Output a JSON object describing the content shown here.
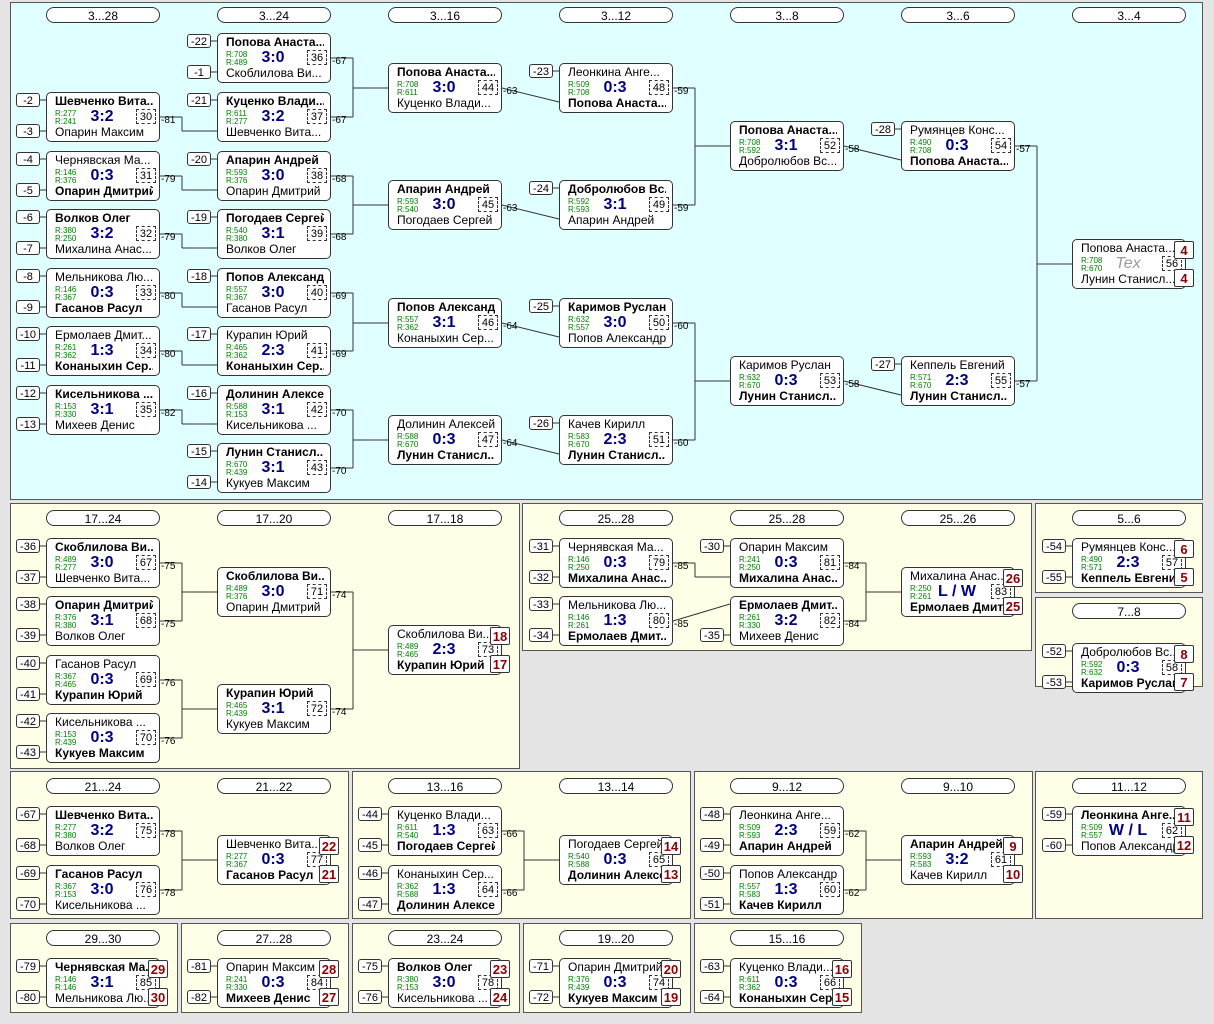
{
  "colors": {
    "top_bg": "#e0ffff",
    "lower_bg": "#ffffe8",
    "outer_bg": "#e4e4e4",
    "win": "#000000",
    "score": "#000080",
    "rating": "#008000",
    "place": "#8b0000"
  },
  "panels": [
    {
      "id": "p1",
      "headers": [
        "3...28",
        "3...24",
        "3...16",
        "3...12",
        "3...8",
        "3...6",
        "3...4"
      ]
    },
    {
      "id": "p2",
      "headers": [
        "17...24",
        "17...20",
        "17...18"
      ]
    },
    {
      "id": "p3",
      "headers": [
        "25...28",
        "25...28",
        "25...26"
      ]
    },
    {
      "id": "p4",
      "headers": [
        "5...6"
      ]
    },
    {
      "id": "p5",
      "headers": [
        "7...8"
      ]
    },
    {
      "id": "p6",
      "headers": [
        "21...24",
        "21...22"
      ]
    },
    {
      "id": "p7",
      "headers": [
        "13...16",
        "13...14"
      ]
    },
    {
      "id": "p8",
      "headers": [
        "9...12",
        "9...10"
      ]
    },
    {
      "id": "p9",
      "headers": [
        "11...12"
      ]
    },
    {
      "id": "p10",
      "headers": [
        "29...30"
      ]
    },
    {
      "id": "p11",
      "headers": [
        "27...28"
      ]
    },
    {
      "id": "p12",
      "headers": [
        "23...24"
      ]
    },
    {
      "id": "p13",
      "headers": [
        "19...20"
      ]
    },
    {
      "id": "p14",
      "headers": [
        "15...16"
      ]
    }
  ],
  "matches": [
    {
      "n1": "Попова Анаста...",
      "n2": "Скоблилова Ви...",
      "r1": "R:708",
      "r2": "R:489",
      "score": "3:0",
      "num": "36",
      "w": 1,
      "s1": "-22",
      "s2": "-1",
      "out": "-67"
    },
    {
      "n1": "Шевченко Вита...",
      "n2": "Опарин Максим",
      "r1": "R:277",
      "r2": "R:241",
      "score": "3:2",
      "num": "30",
      "w": 1,
      "s1": "-2",
      "s2": "-3",
      "out": "-81"
    },
    {
      "n1": "Куценко Влади...",
      "n2": "Шевченко Вита...",
      "r1": "R:611",
      "r2": "R:277",
      "score": "3:2",
      "num": "37",
      "w": 1,
      "s1": "-21",
      "out": "-67"
    },
    {
      "n1": "Чернявская Ма...",
      "n2": "Опарин Дмитрий",
      "r1": "R:146",
      "r2": "R:376",
      "score": "0:3",
      "num": "31",
      "w": 2,
      "s1": "-4",
      "s2": "-5",
      "out": "-79"
    },
    {
      "n1": "Апарин Андрей",
      "n2": "Опарин Дмитрий",
      "r1": "R:593",
      "r2": "R:376",
      "score": "3:0",
      "num": "38",
      "w": 1,
      "s1": "-20",
      "out": "-68"
    },
    {
      "n1": "Волков Олег",
      "n2": "Михалина Анас...",
      "r1": "R:380",
      "r2": "R:250",
      "score": "3:2",
      "num": "32",
      "w": 1,
      "s1": "-6",
      "s2": "-7",
      "out": "-79"
    },
    {
      "n1": "Погодаев Сергей",
      "n2": "Волков Олег",
      "r1": "R:540",
      "r2": "R:380",
      "score": "3:1",
      "num": "39",
      "w": 1,
      "s1": "-19",
      "out": "-68"
    },
    {
      "n1": "Мельникова Лю...",
      "n2": "Гасанов Расул",
      "r1": "R:146",
      "r2": "R:367",
      "score": "0:3",
      "num": "33",
      "w": 2,
      "s1": "-8",
      "s2": "-9",
      "out": "-80"
    },
    {
      "n1": "Попов Александр",
      "n2": "Гасанов Расул",
      "r1": "R:557",
      "r2": "R:367",
      "score": "3:0",
      "num": "40",
      "w": 1,
      "s1": "-18",
      "out": "-69"
    },
    {
      "n1": "Ермолаев Дмит...",
      "n2": "Конаныхин Сер...",
      "r1": "R:261",
      "r2": "R:362",
      "score": "1:3",
      "num": "34",
      "w": 2,
      "s1": "-10",
      "s2": "-11",
      "out": "-80"
    },
    {
      "n1": "Курапин Юрий",
      "n2": "Конаныхин Сер...",
      "r1": "R:465",
      "r2": "R:362",
      "score": "2:3",
      "num": "41",
      "w": 2,
      "s1": "-17",
      "out": "-69"
    },
    {
      "n1": "Кисельникова ...",
      "n2": "Михеев Денис",
      "r1": "R:153",
      "r2": "R:330",
      "score": "3:1",
      "num": "35",
      "w": 1,
      "s1": "-12",
      "s2": "-13",
      "out": "-82"
    },
    {
      "n1": "Долинин Алексей",
      "n2": "Кисельникова ...",
      "r1": "R:588",
      "r2": "R:153",
      "score": "3:1",
      "num": "42",
      "w": 1,
      "s1": "-16",
      "out": "-70"
    },
    {
      "n1": "Лунин Станисл...",
      "n2": "Кукуев Максим",
      "r1": "R:670",
      "r2": "R:439",
      "score": "3:1",
      "num": "43",
      "w": 1,
      "s1": "-15",
      "s2": "-14",
      "out": "-70"
    },
    {
      "n1": "Попова Анаста...",
      "n2": "Куценко Влади...",
      "r1": "R:708",
      "r2": "R:611",
      "score": "3:0",
      "num": "44",
      "w": 1,
      "out": "-63"
    },
    {
      "n1": "Апарин Андрей",
      "n2": "Погодаев Сергей",
      "r1": "R:593",
      "r2": "R:540",
      "score": "3:0",
      "num": "45",
      "w": 1,
      "out": "-63"
    },
    {
      "n1": "Попов Александр",
      "n2": "Конаныхин Сер...",
      "r1": "R:557",
      "r2": "R:362",
      "score": "3:1",
      "num": "46",
      "w": 1,
      "out": "-64"
    },
    {
      "n1": "Долинин Алексей",
      "n2": "Лунин Станисл...",
      "r1": "R:588",
      "r2": "R:670",
      "score": "0:3",
      "num": "47",
      "w": 2,
      "out": "-64"
    },
    {
      "n1": "Леонкина Анге...",
      "n2": "Попова Анаста...",
      "r1": "R:509",
      "r2": "R:708",
      "score": "0:3",
      "num": "48",
      "w": 2,
      "s1": "-23",
      "out": "-59"
    },
    {
      "n1": "Добролюбов Вс...",
      "n2": "Апарин Андрей",
      "r1": "R:592",
      "r2": "R:593",
      "score": "3:1",
      "num": "49",
      "w": 1,
      "s1": "-24",
      "out": "-59"
    },
    {
      "n1": "Каримов Руслан",
      "n2": "Попов Александр",
      "r1": "R:632",
      "r2": "R:557",
      "score": "3:0",
      "num": "50",
      "w": 1,
      "s1": "-25",
      "out": "-60"
    },
    {
      "n1": "Качев Кирилл",
      "n2": "Лунин Станисл...",
      "r1": "R:583",
      "r2": "R:670",
      "score": "2:3",
      "num": "51",
      "w": 2,
      "s1": "-26",
      "out": "-60"
    },
    {
      "n1": "Попова Анаста...",
      "n2": "Добролюбов Вс...",
      "r1": "R:708",
      "r2": "R:592",
      "score": "3:1",
      "num": "52",
      "w": 1,
      "out": "-58"
    },
    {
      "n1": "Каримов Руслан",
      "n2": "Лунин Станисл...",
      "r1": "R:632",
      "r2": "R:670",
      "score": "0:3",
      "num": "53",
      "w": 2,
      "out": "-58"
    },
    {
      "n1": "Румянцев Конс...",
      "n2": "Попова Анаста...",
      "r1": "R:490",
      "r2": "R:708",
      "score": "0:3",
      "num": "54",
      "w": 2,
      "s1": "-28",
      "out": "-57"
    },
    {
      "n1": "Кеппель Евгений",
      "n2": "Лунин Станисл...",
      "r1": "R:571",
      "r2": "R:670",
      "score": "2:3",
      "num": "55",
      "w": 2,
      "s1": "-27",
      "out": "-57"
    },
    {
      "n1": "Попова Анаста...",
      "n2": "Лунин Станисл...",
      "r1": "R:708",
      "r2": "R:670",
      "score": "Tex",
      "tex": 1,
      "num": "56",
      "w": 0,
      "p1": "4",
      "p2": "4"
    },
    {
      "n1": "Скоблилова Ви...",
      "n2": "Шевченко Вита...",
      "r1": "R:489",
      "r2": "R:277",
      "score": "3:0",
      "num": "67",
      "w": 1,
      "s1": "-36",
      "s2": "-37",
      "out": "-75"
    },
    {
      "n1": "Опарин Дмитрий",
      "n2": "Волков Олег",
      "r1": "R:376",
      "r2": "R:380",
      "score": "3:1",
      "num": "68",
      "w": 1,
      "s1": "-38",
      "s2": "-39",
      "out": "-75"
    },
    {
      "n1": "Гасанов Расул",
      "n2": "Курапин Юрий",
      "r1": "R:367",
      "r2": "R:465",
      "score": "0:3",
      "num": "69",
      "w": 2,
      "s1": "-40",
      "s2": "-41",
      "out": "-76"
    },
    {
      "n1": "Кисельникова ...",
      "n2": "Кукуев Максим",
      "r1": "R:153",
      "r2": "R:439",
      "score": "0:3",
      "num": "70",
      "w": 2,
      "s1": "-42",
      "s2": "-43",
      "out": "-76"
    },
    {
      "n1": "Скоблилова Ви...",
      "n2": "Опарин Дмитрий",
      "r1": "R:489",
      "r2": "R:376",
      "score": "3:0",
      "num": "71",
      "w": 1,
      "out": "-74"
    },
    {
      "n1": "Курапин Юрий",
      "n2": "Кукуев Максим",
      "r1": "R:465",
      "r2": "R:439",
      "score": "3:1",
      "num": "72",
      "w": 1,
      "out": "-74"
    },
    {
      "n1": "Скоблилова Ви...",
      "n2": "Курапин Юрий",
      "r1": "R:489",
      "r2": "R:465",
      "score": "2:3",
      "num": "73",
      "w": 2,
      "p1": "18",
      "p2": "17"
    },
    {
      "n1": "Чернявская Ма...",
      "n2": "Михалина Анас...",
      "r1": "R:146",
      "r2": "R:250",
      "score": "0:3",
      "num": "79",
      "w": 2,
      "s1": "-31",
      "s2": "-32",
      "out": "-85"
    },
    {
      "n1": "Мельникова Лю...",
      "n2": "Ермолаев Дмит...",
      "r1": "R:146",
      "r2": "R:261",
      "score": "1:3",
      "num": "80",
      "w": 2,
      "s1": "-33",
      "s2": "-34",
      "out": "-85"
    },
    {
      "n1": "Опарин Максим",
      "n2": "Михалина Анас...",
      "r1": "R:241",
      "r2": "R:250",
      "score": "0:3",
      "num": "81",
      "w": 2,
      "s1": "-30",
      "out": "-84"
    },
    {
      "n1": "Ермолаев Дмит...",
      "n2": "Михеев Денис",
      "r1": "R:261",
      "r2": "R:330",
      "score": "3:2",
      "num": "82",
      "w": 1,
      "s2": "-35",
      "out": "-84"
    },
    {
      "n1": "Михалина Анас...",
      "n2": "Ермолаев Дмит...",
      "r1": "R:250",
      "r2": "R:261",
      "score": "L / W",
      "num": "83",
      "w": 2,
      "p1": "26",
      "p2": "25"
    },
    {
      "n1": "Румянцев Конс...",
      "n2": "Кеппель Евгений",
      "r1": "R:490",
      "r2": "R:571",
      "score": "2:3",
      "num": "57",
      "w": 2,
      "s1": "-54",
      "s2": "-55",
      "p1": "6",
      "p2": "5"
    },
    {
      "n1": "Добролюбов Вс...",
      "n2": "Каримов Руслан",
      "r1": "R:592",
      "r2": "R:632",
      "score": "0:3",
      "num": "58",
      "w": 2,
      "s1": "-52",
      "s2": "-53",
      "p1": "8",
      "p2": "7"
    },
    {
      "n1": "Шевченко Вита...",
      "n2": "Волков Олег",
      "r1": "R:277",
      "r2": "R:380",
      "score": "3:2",
      "num": "75",
      "w": 1,
      "s1": "-67",
      "s2": "-68",
      "out": "-78"
    },
    {
      "n1": "Гасанов Расул",
      "n2": "Кисельникова ...",
      "r1": "R:367",
      "r2": "R:153",
      "score": "3:0",
      "num": "76",
      "w": 1,
      "s1": "-69",
      "s2": "-70",
      "out": "-78"
    },
    {
      "n1": "Шевченко Вита...",
      "n2": "Гасанов Расул",
      "r1": "R:277",
      "r2": "R:367",
      "score": "0:3",
      "num": "77",
      "w": 2,
      "p1": "22",
      "p2": "21"
    },
    {
      "n1": "Куценко Влади...",
      "n2": "Погодаев Сергей",
      "r1": "R:611",
      "r2": "R:540",
      "score": "1:3",
      "num": "63",
      "w": 2,
      "s1": "-44",
      "s2": "-45",
      "out": "-66"
    },
    {
      "n1": "Конаныхин Сер...",
      "n2": "Долинин Алексей",
      "r1": "R:362",
      "r2": "R:588",
      "score": "1:3",
      "num": "64",
      "w": 2,
      "s1": "-46",
      "s2": "-47",
      "out": "-66"
    },
    {
      "n1": "Погодаев Сергей",
      "n2": "Долинин Алексей",
      "r1": "R:540",
      "r2": "R:588",
      "score": "0:3",
      "num": "65",
      "w": 2,
      "p1": "14",
      "p2": "13"
    },
    {
      "n1": "Леонкина Анге...",
      "n2": "Апарин Андрей",
      "r1": "R:509",
      "r2": "R:593",
      "score": "2:3",
      "num": "59",
      "w": 2,
      "s1": "-48",
      "s2": "-49",
      "out": "-62"
    },
    {
      "n1": "Попов Александр",
      "n2": "Качев Кирилл",
      "r1": "R:557",
      "r2": "R:583",
      "score": "1:3",
      "num": "60",
      "w": 2,
      "s1": "-50",
      "s2": "-51",
      "out": "-62"
    },
    {
      "n1": "Апарин Андрей",
      "n2": "Качев Кирилл",
      "r1": "R:593",
      "r2": "R:583",
      "score": "3:2",
      "num": "61",
      "w": 1,
      "p1": "9",
      "p2": "10"
    },
    {
      "n1": "Леонкина Анге...",
      "n2": "Попов Александр",
      "r1": "R:509",
      "r2": "R:557",
      "score": "W / L",
      "num": "62",
      "w": 1,
      "s1": "-59",
      "s2": "-60",
      "p1": "11",
      "p2": "12"
    },
    {
      "n1": "Чернявская Ма...",
      "n2": "Мельникова Лю...",
      "r1": "R:146",
      "r2": "R:146",
      "score": "3:1",
      "num": "85",
      "w": 1,
      "s1": "-79",
      "s2": "-80",
      "p1": "29",
      "p2": "30"
    },
    {
      "n1": "Опарин Максим",
      "n2": "Михеев Денис",
      "r1": "R:241",
      "r2": "R:330",
      "score": "0:3",
      "num": "84",
      "w": 2,
      "s1": "-81",
      "s2": "-82",
      "p1": "28",
      "p2": "27"
    },
    {
      "n1": "Волков Олег",
      "n2": "Кисельникова ...",
      "r1": "R:380",
      "r2": "R:153",
      "score": "3:0",
      "num": "78",
      "w": 1,
      "s1": "-75",
      "s2": "-76",
      "p1": "23",
      "p2": "24"
    },
    {
      "n1": "Опарин Дмитрий",
      "n2": "Кукуев Максим",
      "r1": "R:376",
      "r2": "R:439",
      "score": "0:3",
      "num": "74",
      "w": 2,
      "s1": "-71",
      "s2": "-72",
      "p1": "20",
      "p2": "19"
    },
    {
      "n1": "Куценко Влади...",
      "n2": "Конаныхин Сер...",
      "r1": "R:611",
      "r2": "R:362",
      "score": "0:3",
      "num": "66",
      "w": 2,
      "s1": "-63",
      "s2": "-64",
      "p1": "16",
      "p2": "15"
    }
  ]
}
